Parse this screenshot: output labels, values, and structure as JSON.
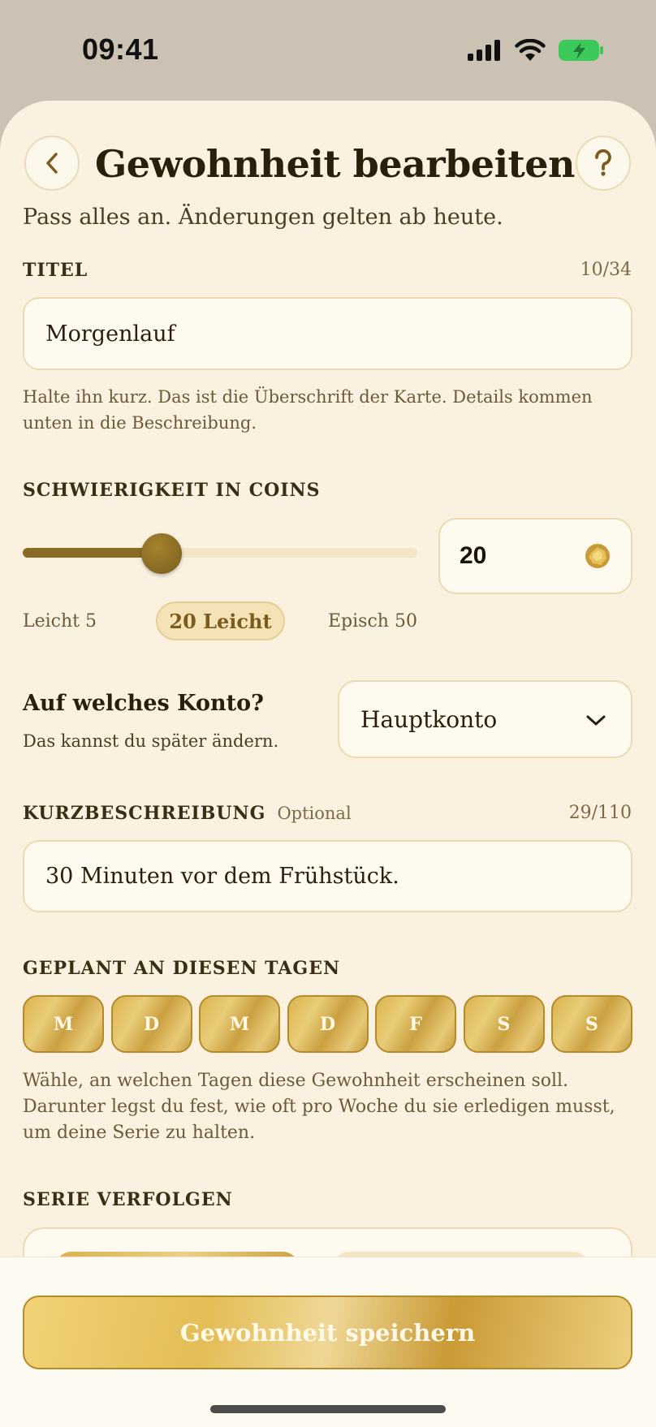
{
  "status_bar": {
    "time": "09:41"
  },
  "header": {
    "title": "Gewohnheit bearbeiten",
    "subtitle": "Pass alles an. Änderungen gelten ab heute."
  },
  "title_field": {
    "label": "TITEL",
    "counter": "10/34",
    "value": "Morgenlauf",
    "hint": "Halte ihn kurz. Das ist die Überschrift der Karte. Details kommen unten in die Beschreibung."
  },
  "difficulty": {
    "label": "SCHWIERIGKEIT IN COINS",
    "value": "20",
    "slider_min": 5,
    "slider_max": 50,
    "slider_value": 20,
    "min_label": "Leicht 5",
    "current_label": "20 Leicht",
    "max_label": "Episch 50"
  },
  "account": {
    "title": "Auf welches Konto?",
    "subtitle": "Das kannst du später ändern.",
    "selected": "Hauptkonto"
  },
  "description": {
    "label": "KURZBESCHREIBUNG",
    "optional": "Optional",
    "counter": "29/110",
    "value": "30 Minuten vor dem Frühstück."
  },
  "schedule": {
    "label": "GEPLANT AN DIESEN TAGEN",
    "days": [
      "M",
      "D",
      "M",
      "D",
      "F",
      "S",
      "S"
    ],
    "hint": "Wähle, an welchen Tagen diese Gewohnheit erscheinen soll. Darunter legst du fest, wie oft pro Woche du sie erledigen musst, um deine Serie zu halten."
  },
  "streak": {
    "label": "SERIE VERFOLGEN"
  },
  "footer": {
    "save_label": "Gewohnheit speichern"
  },
  "colors": {
    "background": "#faf1e1",
    "accent_gold": "#d9b14d",
    "text_dark": "#2a1f0b"
  }
}
